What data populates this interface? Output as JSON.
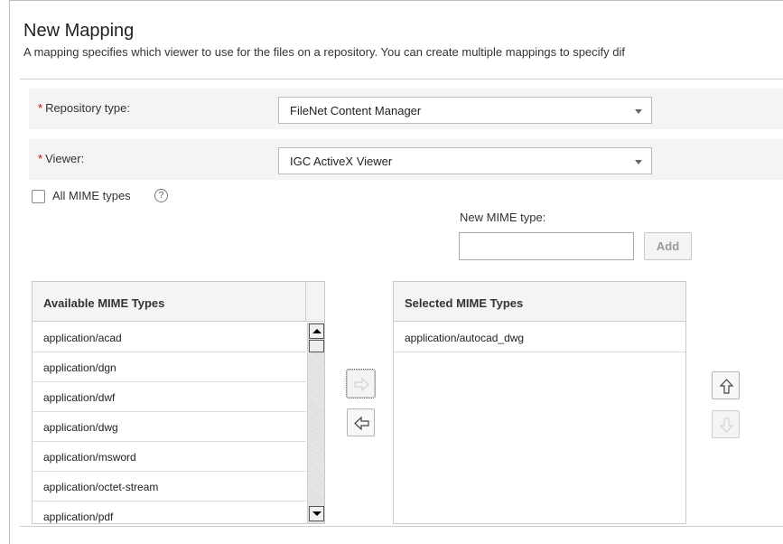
{
  "header": {
    "title": "New Mapping",
    "description": "A mapping specifies which viewer to use for the files on a repository. You can create multiple mappings to specify dif"
  },
  "form": {
    "required_marker": "*",
    "repository_type": {
      "label": "Repository type:",
      "value": "FileNet Content Manager"
    },
    "viewer": {
      "label": "Viewer:",
      "value": "IGC ActiveX Viewer"
    },
    "all_mime_types": {
      "label": "All MIME types",
      "checked": false,
      "help_glyph": "?"
    },
    "new_mime_type": {
      "label": "New MIME type:",
      "value": "",
      "add_label": "Add"
    }
  },
  "available": {
    "header": "Available MIME Types",
    "items": [
      "application/acad",
      "application/dgn",
      "application/dwf",
      "application/dwg",
      "application/msword",
      "application/octet-stream",
      "application/pdf"
    ]
  },
  "selected": {
    "header": "Selected MIME Types",
    "items": [
      "application/autocad_dwg"
    ]
  },
  "icons": {
    "move_right": "arrow-right-icon",
    "move_left": "arrow-left-icon",
    "move_up": "arrow-up-icon",
    "move_down": "arrow-down-icon",
    "dropdown": "chevron-down-icon",
    "help": "help-circle-icon"
  },
  "colors": {
    "required": "#cc0000",
    "row_background": "#f4f4f4",
    "border": "#c9c9c9"
  }
}
